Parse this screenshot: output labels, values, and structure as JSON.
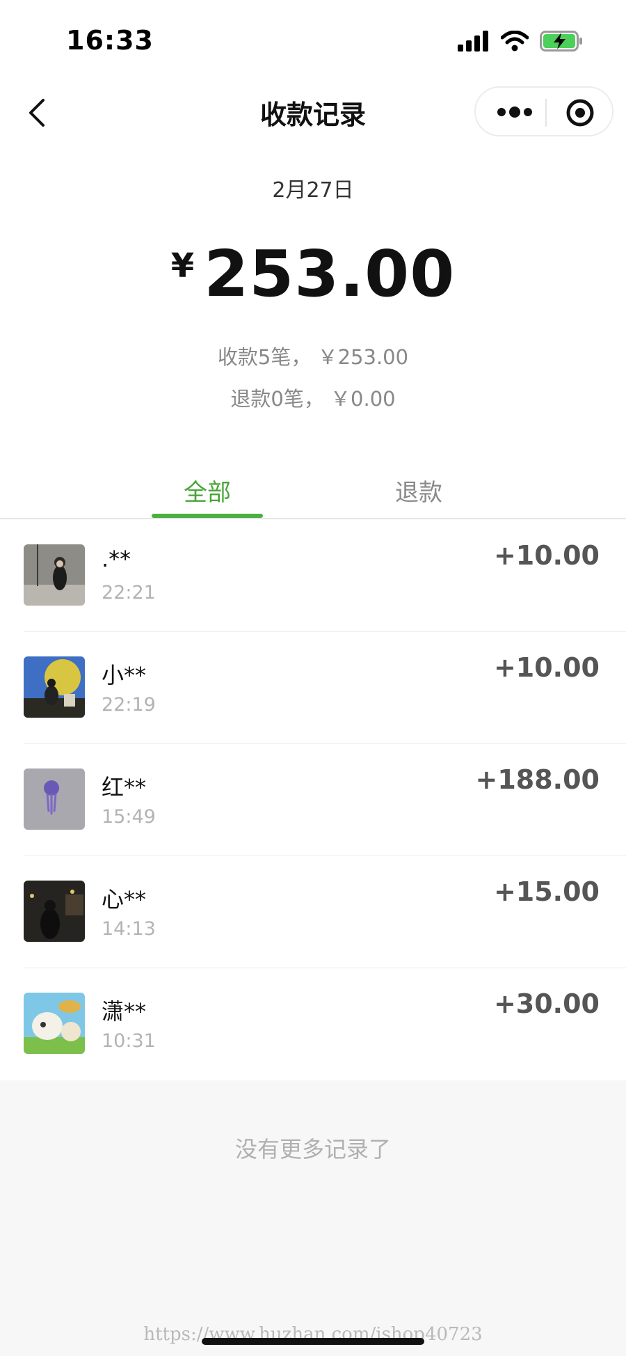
{
  "status_bar": {
    "time": "16:33"
  },
  "nav": {
    "title": "收款记录"
  },
  "summary": {
    "date": "2月27日",
    "currency": "¥",
    "total": "253.00",
    "received": "收款5笔， ￥253.00",
    "refunded": "退款0笔， ￥0.00"
  },
  "tabs": [
    {
      "label": "全部",
      "active": true
    },
    {
      "label": "退款",
      "active": false
    }
  ],
  "records": [
    {
      "name": ".**",
      "time": "22:21",
      "amount": "+10.00"
    },
    {
      "name": "小**",
      "time": "22:19",
      "amount": "+10.00"
    },
    {
      "name": "红**",
      "time": "15:49",
      "amount": "+188.00"
    },
    {
      "name": "心**",
      "time": "14:13",
      "amount": "+15.00"
    },
    {
      "name": "潇**",
      "time": "10:31",
      "amount": "+30.00"
    }
  ],
  "footer": {
    "no_more": "没有更多记录了",
    "watermark": "https://www.huzhan.com/ishop40723"
  },
  "colors": {
    "accent": "#4caf3f",
    "muted": "#888888",
    "footer_bg": "#f7f7f7"
  }
}
